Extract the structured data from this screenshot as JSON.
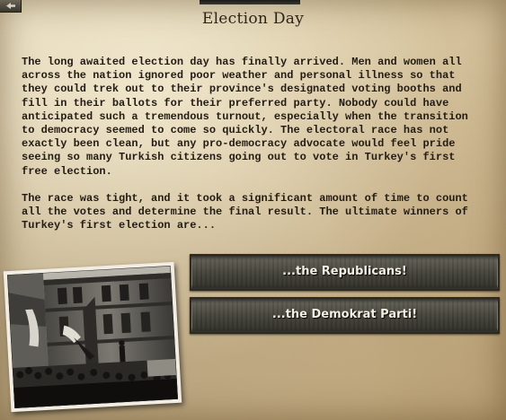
{
  "event": {
    "title": "Election Day",
    "paragraphs": [
      "The long awaited election day has finally arrived. Men and women all across the nation ignored poor weather and personal illness so that they could trek out to their province's designated voting booths and fill in their ballots for their preferred party. Nobody could have anticipated such a tremendous turnout, especially when the transition to democracy seemed to come so quickly. The electoral race has not exactly been clean, but any pro-democracy advocate would feel pride seeing so many Turkish citizens going out to vote in Turkey's first free election.",
      "The race was tight, and it took a significant amount of time to count all the votes and determine the final result. The ultimate winners of Turkey's first election are..."
    ],
    "options": [
      {
        "label": "...the Republicans!"
      },
      {
        "label": "...the Demokrat Parti!"
      }
    ]
  },
  "icons": {
    "close": "back-arrow-icon"
  },
  "colors": {
    "parchment": "#d8c7a2",
    "text": "#221c12",
    "button": "#45443a",
    "button_text": "#f3efe2"
  }
}
